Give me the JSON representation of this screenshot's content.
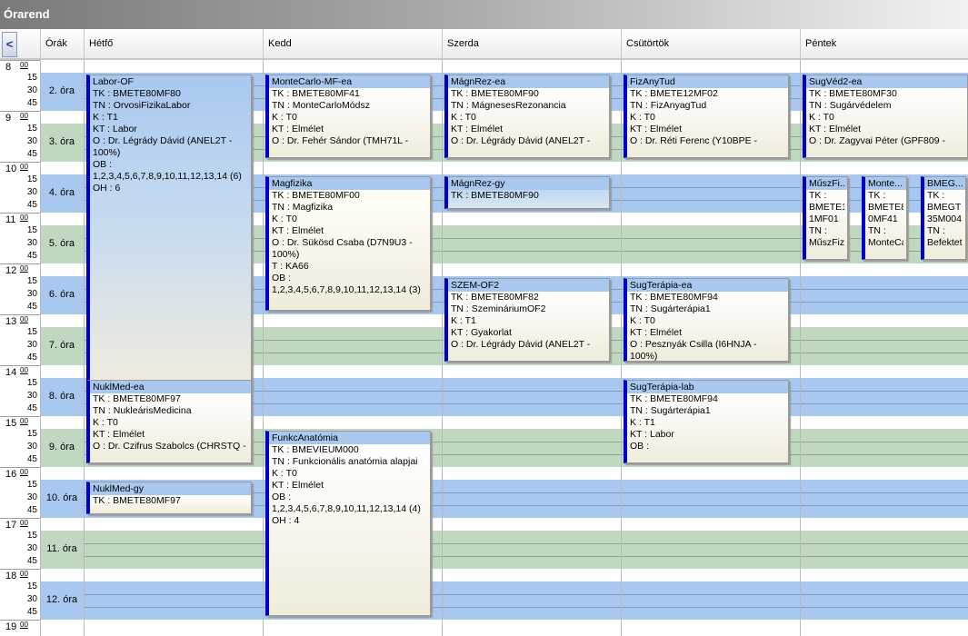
{
  "window": {
    "title": "Órarend"
  },
  "header": {
    "nav_label": "<",
    "col_hours": "Órák",
    "days": [
      "Hétfő",
      "Kedd",
      "Szerda",
      "Csütörtök",
      "Péntek"
    ]
  },
  "hours": [
    "8",
    "9",
    "10",
    "11",
    "12",
    "13",
    "14",
    "15",
    "16",
    "17",
    "18",
    "19"
  ],
  "hour_sup": "00",
  "minutes": [
    "15",
    "30",
    "45"
  ],
  "periods": [
    "2. óra",
    "3. óra",
    "4. óra",
    "5. óra",
    "6. óra",
    "7. óra",
    "8. óra",
    "9. óra",
    "10. óra",
    "11. óra",
    "12. óra"
  ],
  "events": [
    {
      "day": 0,
      "title": "Labor-OF",
      "lines": [
        "TK : BMETE80MF80",
        "TN : OrvosiFizikaLabor",
        "K : T1",
        "KT : Labor",
        "O :  Dr. Légrády Dávid (ANEL2T - 100%)",
        "OB :",
        "1,2,3,4,5,6,7,8,9,10,11,12,13,14 (6)",
        "OH : 6"
      ]
    },
    {
      "day": 0,
      "title": "NuklMed-ea",
      "lines": [
        "TK : BMETE80MF97",
        "TN : NukleárisMedicina",
        "K : T0",
        "KT : Elmélet",
        "O :  Dr. Czifrus Szabolcs (CHRSTQ -"
      ]
    },
    {
      "day": 0,
      "title": "NuklMed-gy",
      "lines": [
        "TK : BMETE80MF97"
      ]
    },
    {
      "day": 1,
      "title": "MonteCarlo-MF-ea",
      "lines": [
        "TK : BMETE80MF41",
        "TN : MonteCarloMódsz",
        "K : T0",
        "KT : Elmélet",
        "O :  Dr. Fehér Sándor (TMH71L -"
      ]
    },
    {
      "day": 1,
      "title": "Magfizika",
      "lines": [
        "TK : BMETE80MF00",
        "TN : Magfizika",
        "K : T0",
        "KT : Elmélet",
        "O :  Dr. Sükösd Csaba (D7N9U3 - 100%)",
        "T : KA66",
        "OB :",
        "1,2,3,4,5,6,7,8,9,10,11,12,13,14 (3)"
      ]
    },
    {
      "day": 1,
      "title": "FunkcAnatómia",
      "lines": [
        "TK : BMEVIEUM000",
        "TN : Funkcionális anatómia alapjai",
        "K : T0",
        "KT : Elmélet",
        "OB :",
        "1,2,3,4,5,6,7,8,9,10,11,12,13,14 (4)",
        "OH : 4"
      ]
    },
    {
      "day": 2,
      "title": "MágnRez-ea",
      "lines": [
        "TK : BMETE80MF90",
        "TN : MágnesesRezonancia",
        "K : T0",
        "KT : Elmélet",
        "O :  Dr. Légrády Dávid (ANEL2T -"
      ]
    },
    {
      "day": 2,
      "title": "MágnRez-gy",
      "lines": [
        "TK : BMETE80MF90"
      ]
    },
    {
      "day": 2,
      "title": "SZEM-OF2",
      "lines": [
        "TK : BMETE80MF82",
        "TN : SzemináriumOF2",
        "K : T1",
        "KT : Gyakorlat",
        "O :  Dr. Légrády Dávid (ANEL2T -"
      ]
    },
    {
      "day": 3,
      "title": "FizAnyTud",
      "lines": [
        "TK : BMETE12MF02",
        "TN : FizAnyagTud",
        "K : T0",
        "KT : Elmélet",
        "O :  Dr. Réti Ferenc (Y10BPE -"
      ]
    },
    {
      "day": 3,
      "title": "SugTerápia-ea",
      "lines": [
        "TK : BMETE80MF94",
        "TN : Sugárterápia1",
        "K : T0",
        "KT : Elmélet",
        "O :  Pesznyák Csilla (I6HNJA - 100%)"
      ]
    },
    {
      "day": 3,
      "title": "SugTerápia-lab",
      "lines": [
        "TK : BMETE80MF94",
        "TN : Sugárterápia1",
        "K : T1",
        "KT : Labor",
        "OB :"
      ]
    },
    {
      "day": 4,
      "title": "SugVéd2-ea",
      "lines": [
        "TK : BMETE80MF30",
        "TN : Sugárvédelem",
        "K : T0",
        "KT : Elmélet",
        "O :  Dr. Zagyvai Péter (GPF809 -"
      ]
    },
    {
      "day": 4,
      "title": "MűszFi...",
      "lines": [
        "TK :",
        "BMETE1",
        "1MF01",
        "TN :",
        "MűszFiz"
      ]
    },
    {
      "day": 4,
      "title": "Monte...",
      "lines": [
        "TK :",
        "BMETE8",
        "0MF41",
        "TN :",
        "MonteCa"
      ]
    },
    {
      "day": 4,
      "title": "BMEG...",
      "lines": [
        "TK :",
        "BMEGT",
        "35M004",
        "TN :",
        "Befektet"
      ]
    }
  ]
}
